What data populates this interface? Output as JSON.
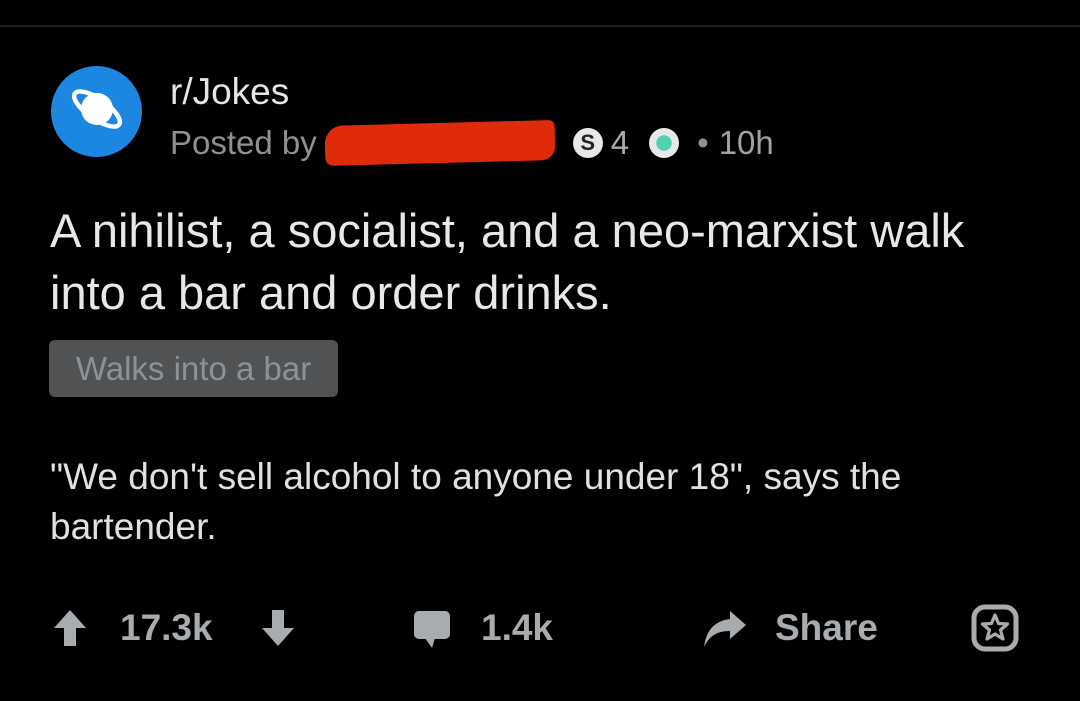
{
  "header": {
    "subreddit": "r/Jokes",
    "posted_by": "Posted by",
    "silver_badge_letter": "S",
    "award_count": "4",
    "separator": "•",
    "age": "10h",
    "avatar_icon": "planet-icon",
    "avatar_color": "#1c87e0",
    "redaction_color": "#e02a0c"
  },
  "post": {
    "title": "A nihilist, a socialist, and a neo-marxist walk into a bar and order drinks.",
    "flair": "Walks into a bar",
    "body": "\"We don't sell alcohol to anyone under 18\", says the bartender."
  },
  "actions": {
    "upvote_icon": "arrow-up-icon",
    "score": "17.3k",
    "downvote_icon": "arrow-down-icon",
    "comments_icon": "comment-bubble-icon",
    "comments": "1.4k",
    "share_icon": "share-arrow-icon",
    "share": "Share",
    "award_icon": "award-icon"
  }
}
